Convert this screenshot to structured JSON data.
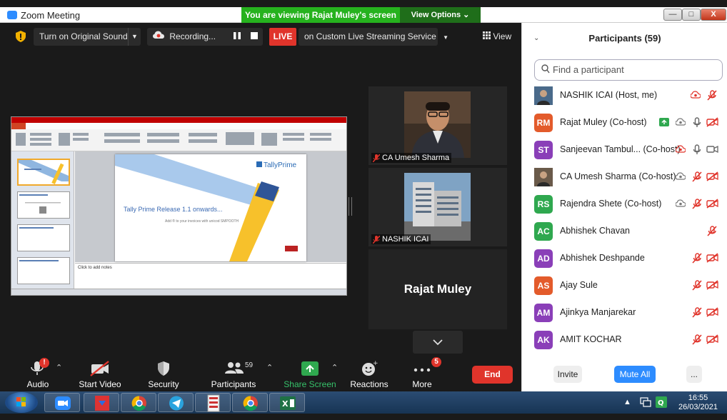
{
  "window": {
    "title": "Zoom Meeting",
    "viewing_banner": "You are viewing Rajat Muley's screen",
    "view_options": "View Options",
    "minimize": "—",
    "maximize": "□",
    "close": "X"
  },
  "top_bar": {
    "original_sound": "Turn on Original Sound",
    "recording": "Recording...",
    "live_badge": "LIVE",
    "live_service": "on Custom Live Streaming Service",
    "view": "View"
  },
  "shared_slide": {
    "brand": "TallyPrime",
    "headline": "Tally Prime Release 1.1 onwards...",
    "subline": "Add ® to your invoices with unicod SMPOOTH",
    "notes_placeholder": "Click to add notes",
    "thumbnail_title": "Key Considerations to complete..."
  },
  "video_tiles": [
    {
      "name": "CA Umesh Sharma"
    },
    {
      "name": "NASHIK ICAI"
    },
    {
      "name": "Rajat Muley"
    }
  ],
  "toolbar": {
    "audio": "Audio",
    "audio_badge": "!",
    "start_video": "Start Video",
    "security": "Security",
    "participants": "Participants",
    "participants_count": "59",
    "share_screen": "Share Screen",
    "reactions": "Reactions",
    "more": "More",
    "more_badge": "5",
    "end": "End"
  },
  "participants_panel": {
    "title": "Participants (59)",
    "search_placeholder": "Find a participant",
    "invite": "Invite",
    "mute_all": "Mute All",
    "more": "..."
  },
  "participants": [
    {
      "initials": "",
      "name": "NASHIK ICAI (Host, me)",
      "avatar_color": "#4a6a8a",
      "photo": true
    },
    {
      "initials": "RM",
      "name": "Rajat Muley (Co-host)",
      "avatar_color": "#e35b2b",
      "photo": false
    },
    {
      "initials": "ST",
      "name": "Sanjeevan Tambul... (Co-host)",
      "avatar_color": "#8a3fb8",
      "photo": false
    },
    {
      "initials": "",
      "name": "CA Umesh Sharma (Co-host)",
      "avatar_color": "#6a5a4a",
      "photo": true
    },
    {
      "initials": "RS",
      "name": "Rajendra Shete (Co-host)",
      "avatar_color": "#2fa84f",
      "photo": false
    },
    {
      "initials": "AC",
      "name": "Abhishek Chavan",
      "avatar_color": "#2fa84f",
      "photo": false
    },
    {
      "initials": "AD",
      "name": "Abhishek Deshpande",
      "avatar_color": "#8a3fb8",
      "photo": false
    },
    {
      "initials": "AS",
      "name": "Ajay Sule",
      "avatar_color": "#e35b2b",
      "photo": false
    },
    {
      "initials": "AM",
      "name": "Ajinkya Manjarekar",
      "avatar_color": "#8a3fb8",
      "photo": false
    },
    {
      "initials": "AK",
      "name": "AMIT KOCHAR",
      "avatar_color": "#8a3fb8",
      "photo": false
    }
  ],
  "taskbar": {
    "time": "16:55",
    "date": "26/03/2021",
    "tally_label": "Tally ERP9"
  }
}
